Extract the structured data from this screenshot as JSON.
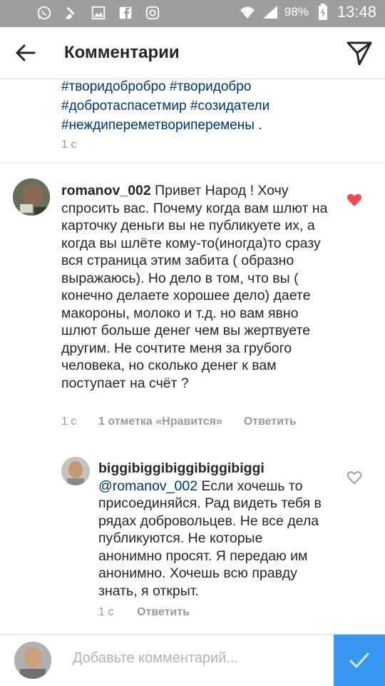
{
  "status_bar": {
    "battery_percent": "98%",
    "time": "13:48",
    "icons": [
      "whatsapp-icon",
      "cleaner-icon",
      "gallery-icon",
      "facebook-icon",
      "instagram-icon",
      "wifi-icon",
      "signal-icon",
      "battery-icon"
    ]
  },
  "header": {
    "title": "Комментарии",
    "icons": [
      "back-arrow-icon",
      "send-icon"
    ]
  },
  "caption": {
    "line1": "#творидобробро #творидобро",
    "line2": "#добротаспасетмир #созидатели",
    "line3": "#неждипереметвориперемены",
    "line3_end": " .",
    "time": "1 с"
  },
  "comments": [
    {
      "username": "romanov_002",
      "text": " Привет Народ ! Хочу спросить вас. Почему когда вам шлют на карточку деньги вы не публикуете их, а когда вы шлёте кому-то(иногда)то сразу вся страница этим забита  ( образно выражаюсь). Но дело в том, что вы  ( конечно делаете хорошее дело) даете макороны, молоко и т.д.  но вам явно шлют больше денег чем вы жертвуете другим. Не сочтите меня за грубого человека, но сколько денег к вам поступает на счёт ?",
      "time": "1 с",
      "likes": "1 отметка «Нравится»",
      "reply": "Ответить",
      "liked": true,
      "heart_color": "#ed4956"
    },
    {
      "username": "biggibiggibiggibiggibiggi",
      "mention": "@romanov_002",
      "text": " Если хочешь то присоединяйся. Рад видеть тебя в рядах добровольцев. Не все дела публикуются. Не которые анонимно просят. Я передаю им анонимно. Хочешь всю правду знать, я открыт.",
      "time": "1 с",
      "reply": "Ответить",
      "liked": false
    }
  ],
  "composer": {
    "placeholder": "Добавьте комментарий...",
    "post_button_color": "#3897f0"
  },
  "colors": {
    "status_bar": "#9e9e9e",
    "link": "#003569",
    "meta": "#999999"
  }
}
